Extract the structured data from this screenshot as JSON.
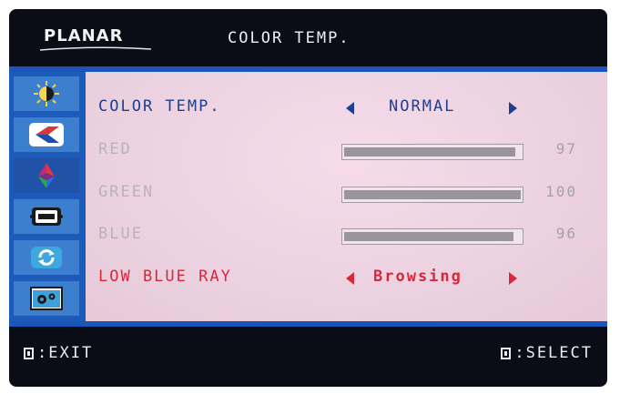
{
  "header": {
    "brand": "PLANAR",
    "title": "COLOR TEMP."
  },
  "sidebar": {
    "items": [
      {
        "icon": "brightness-contrast-icon"
      },
      {
        "icon": "image-position-icon"
      },
      {
        "icon": "color-icon"
      },
      {
        "icon": "osd-icon"
      },
      {
        "icon": "reset-icon"
      },
      {
        "icon": "setup-icon"
      }
    ]
  },
  "menu": {
    "color_temp": {
      "label": "COLOR TEMP.",
      "value": "NORMAL"
    },
    "red": {
      "label": "RED",
      "value": 97
    },
    "green": {
      "label": "GREEN",
      "value": 100
    },
    "blue": {
      "label": "BLUE",
      "value": 96
    },
    "low_blue_ray": {
      "label": "LOW BLUE RAY",
      "value": "Browsing"
    }
  },
  "footer": {
    "exit_label": ":EXIT",
    "select_label": ":SELECT"
  },
  "colors": {
    "active_text": "#1f3f8f",
    "disabled_text": "#b9b2bb",
    "highlight_text": "#d6293b",
    "sidebar": "#1d5ab9"
  }
}
